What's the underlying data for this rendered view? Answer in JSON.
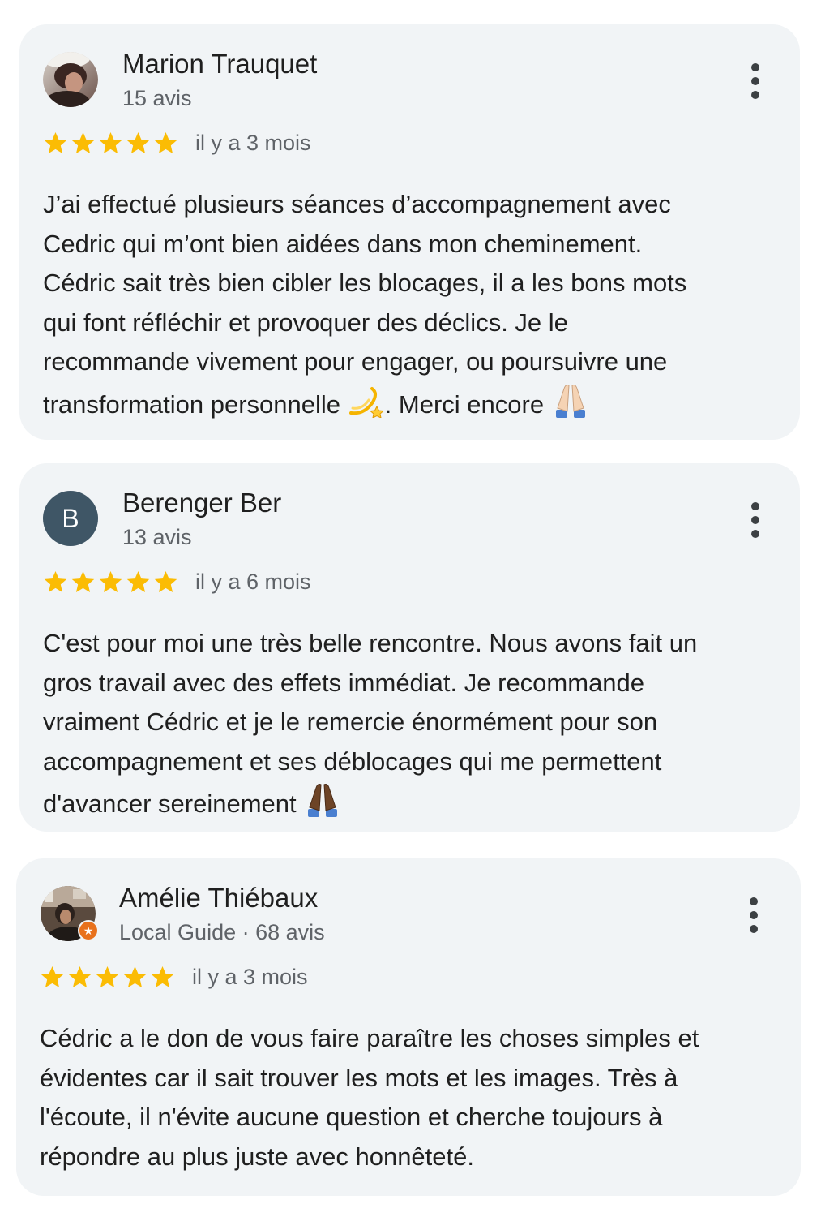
{
  "reviews": [
    {
      "name": "Marion Trauquet",
      "meta": "15 avis",
      "avatar_letter": "",
      "rating": 5,
      "date": "il y a 3 mois",
      "text_lines": [
        "J’ai effectué plusieurs séances d’accompagnement avec",
        "Cedric qui m’ont bien aidées dans mon cheminement.",
        "Cédric sait très bien cibler les blocages, il a les bons mots",
        "qui font réfléchir et provoquer des déclics. Je le",
        "recommande vivement pour engager, ou poursuivre une"
      ],
      "text_last_a": "transformation personnelle",
      "text_last_b": ". Merci encore",
      "emoji_a": "dizzy-emoji",
      "emoji_b": "folded-hands-emoji-light"
    },
    {
      "name": "Berenger Ber",
      "meta": "13 avis",
      "avatar_letter": "B",
      "rating": 5,
      "date": "il y a 6 mois",
      "text_lines": [
        "C'est pour moi une très belle rencontre. Nous avons fait un",
        "gros travail avec des effets immédiat. Je recommande",
        "vraiment Cédric et je le remercie énormément pour son",
        "accompagnement et ses déblocages qui me permettent"
      ],
      "text_last_a": "d'avancer sereinement",
      "emoji_a": "folded-hands-emoji-dark"
    },
    {
      "name": "Amélie Thiébaux",
      "meta": "Local Guide · 68 avis",
      "avatar_letter": "",
      "rating": 5,
      "date": "il y a 3 mois",
      "text_lines": [
        "Cédric a le don de vous faire paraître les choses simples et",
        "évidentes car il sait trouver les mots et les images. Très à",
        "l'écoute, il n'évite aucune question et cherche toujours à",
        "répondre au plus juste avec honnêteté."
      ]
    }
  ],
  "colors": {
    "card_bg": "#f1f4f6",
    "star": "#fbbc04",
    "secondary_text": "#5f6368",
    "letter_avatar_bg": "#3f5666",
    "local_guide_badge": "#e8711c"
  },
  "icons": {
    "more": "more-vert-icon",
    "star": "star-icon",
    "badge": "local-guide-badge-icon"
  }
}
